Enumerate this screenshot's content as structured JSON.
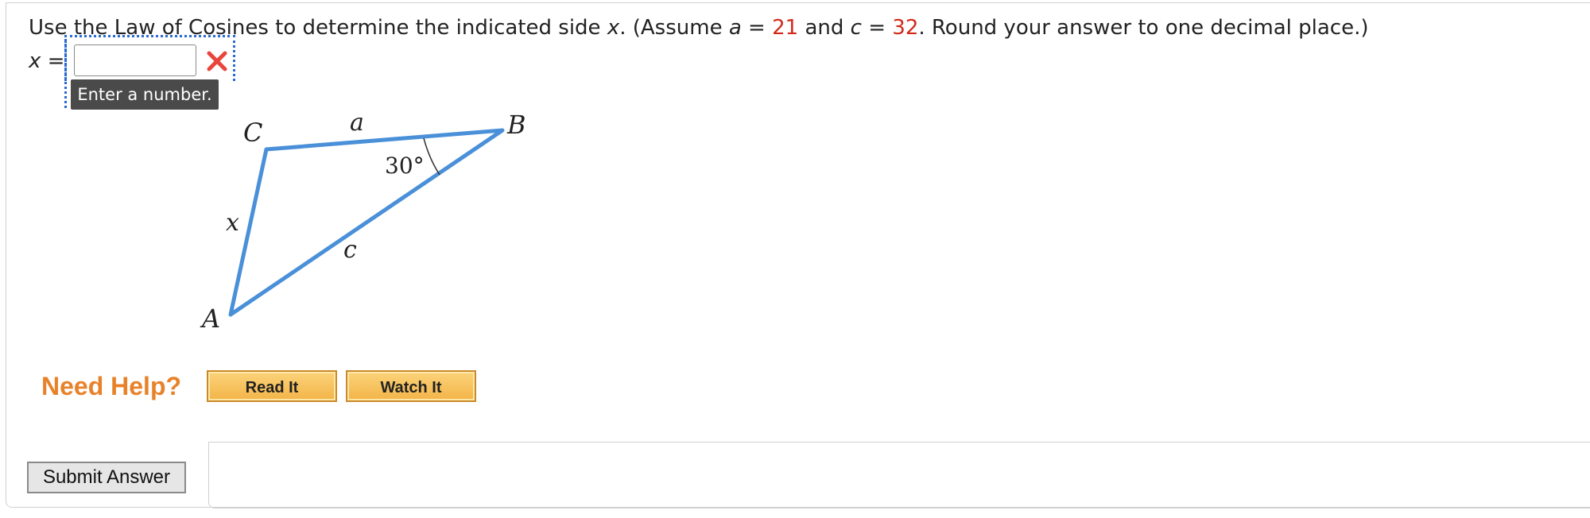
{
  "question": {
    "prefix": "Use the Law of Cosines to determine the indicated side ",
    "var_x": "x",
    "mid1": ". (Assume ",
    "var_a": "a",
    "eq1": " = ",
    "a_value": "21",
    "and": " and ",
    "var_c": "c",
    "eq2": " = ",
    "c_value": "32",
    "suffix": ". Round your answer to one decimal place.)"
  },
  "answer": {
    "label_var": "x",
    "label_eq": " =",
    "value": "",
    "status": "incorrect",
    "tooltip": "Enter a number."
  },
  "diagram": {
    "vertex_C": "C",
    "vertex_B": "B",
    "vertex_A": "A",
    "side_a": "a",
    "side_c": "c",
    "side_x": "x",
    "angle_B": "30°",
    "line_color": "#4a90d9"
  },
  "help": {
    "label": "Need Help?",
    "read_it": "Read It",
    "watch_it": "Watch It"
  },
  "submit": {
    "label": "Submit Answer"
  },
  "colors": {
    "given_value": "#d12a1b",
    "need_help": "#e8822a",
    "help_button": "#f3b448",
    "tooltip_bg": "#4a4a4a",
    "focus_ring": "#2a6bd1"
  }
}
